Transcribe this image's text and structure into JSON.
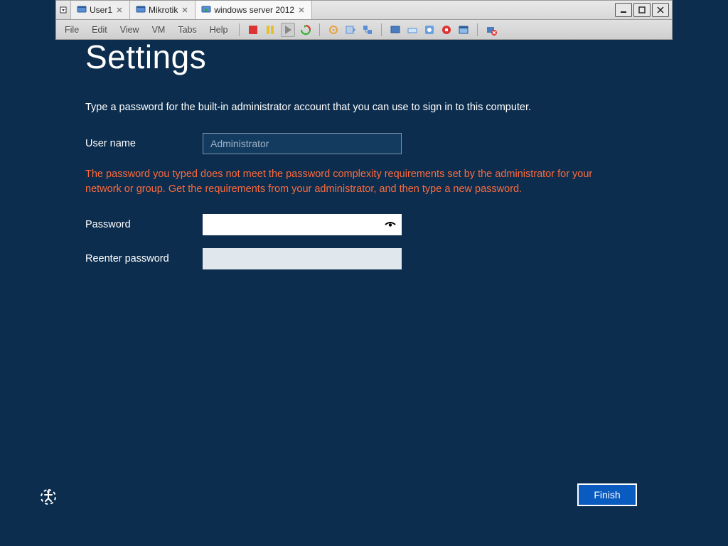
{
  "vmware": {
    "tabs": [
      {
        "label": "User1",
        "active": false
      },
      {
        "label": "Mikrotik",
        "active": false
      },
      {
        "label": "windows server 2012",
        "active": true
      }
    ],
    "menu": {
      "file": "File",
      "edit": "Edit",
      "view": "View",
      "vm": "VM",
      "tabs": "Tabs",
      "help": "Help"
    },
    "toolbar_icons": [
      "stop-icon",
      "pause-icon",
      "play-icon",
      "restart-icon",
      "snapshot-icon",
      "snapshot-revert-icon",
      "snapshot-manager-icon",
      "fullscreen-icon",
      "unity-icon",
      "install-tools-icon",
      "record-icon",
      "window-icon",
      "disconnect-device-icon"
    ]
  },
  "oobe": {
    "title": "Settings",
    "prompt": "Type a password for the built-in administrator account that you can use to sign in to this computer.",
    "username_label": "User name",
    "username_value": "Administrator",
    "error_msg": "The password you typed does not meet the password complexity requirements set by the administrator for your network or group. Get the requirements from your administrator, and then type a new password.",
    "password_label": "Password",
    "password_value": "",
    "reenter_label": "Reenter password",
    "reenter_value": "",
    "finish_label": "Finish"
  },
  "colors": {
    "bg": "#0c2d4e",
    "accent": "#0a5bbf",
    "error": "#ff6a3c"
  }
}
